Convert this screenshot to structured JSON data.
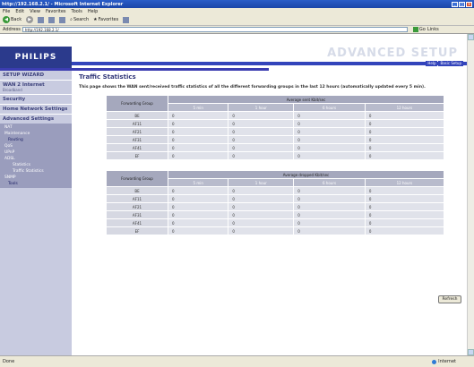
{
  "window": {
    "title": "http://192.168.2.1/ - Microsoft Internet Explorer"
  },
  "menu": [
    "File",
    "Edit",
    "View",
    "Favorites",
    "Tools",
    "Help"
  ],
  "toolbar": {
    "back": "Back",
    "search": "Search",
    "favorites": "Favorites"
  },
  "address": {
    "label": "Address",
    "url": "http://192.168.2.1/",
    "go": "Go",
    "links": "Links"
  },
  "header": {
    "logo": "PHILIPS",
    "banner": "ADVANCED SETUP",
    "link_help": "Help",
    "link_logout": "Basic Setup"
  },
  "sidebar": {
    "items": [
      {
        "label": "SETUP WIZARD"
      },
      {
        "label": "WAN 2 Internet",
        "sub": "Broadband"
      },
      {
        "label": "Security"
      },
      {
        "label": "Home Network Settings"
      },
      {
        "label": "Advanced Settings"
      }
    ],
    "advanced": [
      "NAT",
      "Maintenance",
      "Routing",
      "QoS",
      "UPnP",
      "ADSL",
      "Statistics",
      "Traffic Statistics"
    ],
    "after": [
      "SNMP",
      "Tools"
    ]
  },
  "main": {
    "title": "Traffic Statistics",
    "description": "This page shows the WAN sent/received traffic statistics of all the different forwarding groups in the last 12 hours (automatically updated every 5 min)."
  },
  "table_sent": {
    "group_header": "Forwarding Group",
    "value_header": "Average sent Kbit/sec",
    "columns": [
      "5 min",
      "1 hour",
      "6 hours",
      "12 hours"
    ],
    "rows": [
      {
        "group": "BE",
        "values": [
          "0",
          "0",
          "0",
          "0"
        ]
      },
      {
        "group": "AF11",
        "values": [
          "0",
          "0",
          "0",
          "0"
        ]
      },
      {
        "group": "AF21",
        "values": [
          "0",
          "0",
          "0",
          "0"
        ]
      },
      {
        "group": "AF31",
        "values": [
          "0",
          "0",
          "0",
          "0"
        ]
      },
      {
        "group": "AF41",
        "values": [
          "0",
          "0",
          "0",
          "0"
        ]
      },
      {
        "group": "EF",
        "values": [
          "0",
          "0",
          "0",
          "0"
        ]
      }
    ]
  },
  "table_dropped": {
    "group_header": "Forwarding Group",
    "value_header": "Average dropped Kbit/sec",
    "columns": [
      "5 min",
      "1 hour",
      "6 hours",
      "12 hours"
    ],
    "rows": [
      {
        "group": "BE",
        "values": [
          "0",
          "0",
          "0",
          "0"
        ]
      },
      {
        "group": "AF11",
        "values": [
          "0",
          "0",
          "0",
          "0"
        ]
      },
      {
        "group": "AF21",
        "values": [
          "0",
          "0",
          "0",
          "0"
        ]
      },
      {
        "group": "AF31",
        "values": [
          "0",
          "0",
          "0",
          "0"
        ]
      },
      {
        "group": "AF41",
        "values": [
          "0",
          "0",
          "0",
          "0"
        ]
      },
      {
        "group": "EF",
        "values": [
          "0",
          "0",
          "0",
          "0"
        ]
      }
    ]
  },
  "buttons": {
    "refresh": "Refresh"
  },
  "status": {
    "left": "Done",
    "right": "Internet"
  },
  "colors": {
    "brand": "#2b3a8c",
    "bar": "#3344bb",
    "sidebar": "#c8cbe0",
    "table_header": "#a5a8bd"
  }
}
